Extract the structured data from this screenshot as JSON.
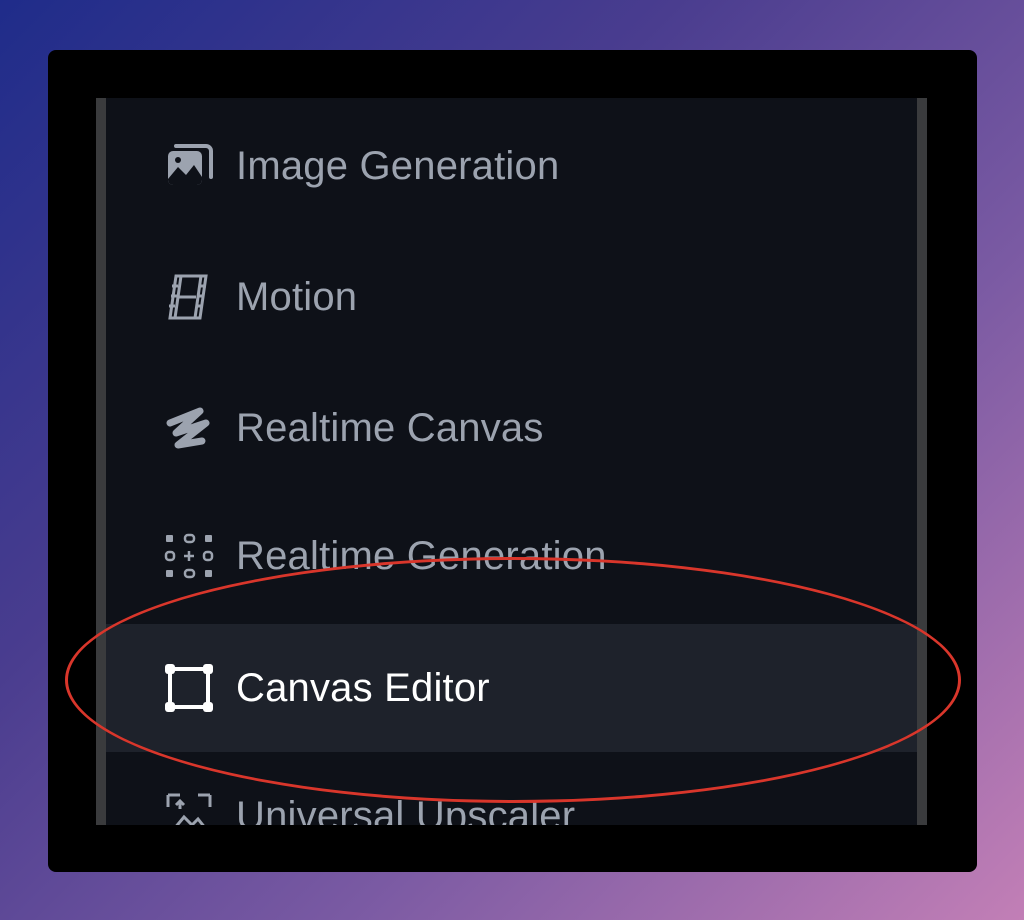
{
  "nav": {
    "items": [
      {
        "label": "Image Generation",
        "icon": "image-stack-icon",
        "active": false
      },
      {
        "label": "Motion",
        "icon": "film-icon",
        "active": false
      },
      {
        "label": "Realtime Canvas",
        "icon": "brush-stroke-icon",
        "active": false
      },
      {
        "label": "Realtime Generation",
        "icon": "dots-grid-icon",
        "active": false
      },
      {
        "label": "Canvas Editor",
        "icon": "transform-frame-icon",
        "active": true
      },
      {
        "label": "Universal Upscaler",
        "icon": "upscale-image-icon",
        "active": false
      }
    ]
  },
  "colors": {
    "panel_bg": "#0e1118",
    "active_bg": "#1e222b",
    "inactive_text": "#9ca3af",
    "active_text": "#ffffff",
    "annotation": "#d9362b"
  }
}
